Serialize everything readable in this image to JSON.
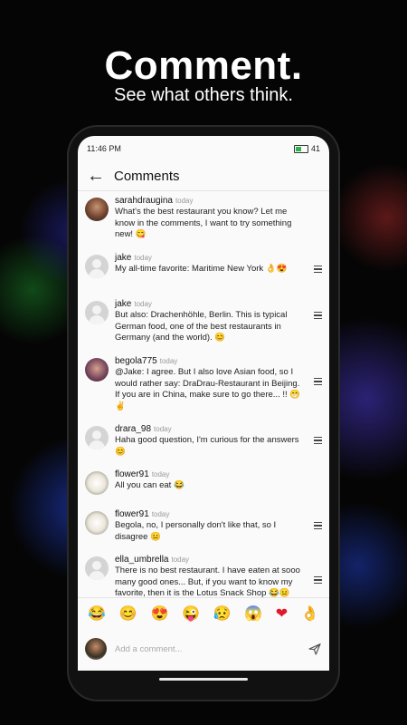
{
  "promo": {
    "title": "Comment.",
    "subtitle": "See what others think."
  },
  "status": {
    "time": "11:46 PM",
    "battery": "41"
  },
  "header": {
    "title": "Comments"
  },
  "comments": [
    {
      "user": "sarahdraugina",
      "time": "today",
      "text": "What's the best restaurant you know? Let me know in the comments, I want to try something new! 😋",
      "avatar": "photo",
      "menu": false
    },
    {
      "user": "jake",
      "time": "today",
      "text": "My all-time favorite: Maritime New York 👌😍",
      "avatar": "default",
      "menu": true
    },
    {
      "user": "jake",
      "time": "today",
      "text": "But also: Drachenhöhle, Berlin. This is typical German food, one of the best restaurants in Germany (and the world). 😊",
      "avatar": "default",
      "menu": true
    },
    {
      "user": "begola775",
      "time": "today",
      "text": "@Jake: I agree. But I also love Asian food, so I would rather say: DraDrau-Restaurant in Beijing. If you are in China, make sure to go there... !! 😁✌",
      "avatar": "photo",
      "menu": true
    },
    {
      "user": "drara_98",
      "time": "today",
      "text": "Haha good question, I'm curious for the answers 😊",
      "avatar": "default",
      "menu": true
    },
    {
      "user": "flower91",
      "time": "today",
      "text": "All you can eat 😂",
      "avatar": "photo",
      "menu": false
    },
    {
      "user": "flower91",
      "time": "today",
      "text": "Begola, no, I personally don't like that, so I disagree 😐",
      "avatar": "photo",
      "menu": true
    },
    {
      "user": "ella_umbrella",
      "time": "today",
      "text": "There is no best restaurant. I have eaten at sooo many good ones... But, if you want to know my favorite, then it is the Lotus Snack Shop 😂😐",
      "avatar": "default",
      "menu": true
    }
  ],
  "emojis": [
    "😂",
    "😊",
    "😍",
    "😜",
    "😥",
    "😱",
    "❤",
    "👌"
  ],
  "composer": {
    "placeholder": "Add a comment..."
  }
}
